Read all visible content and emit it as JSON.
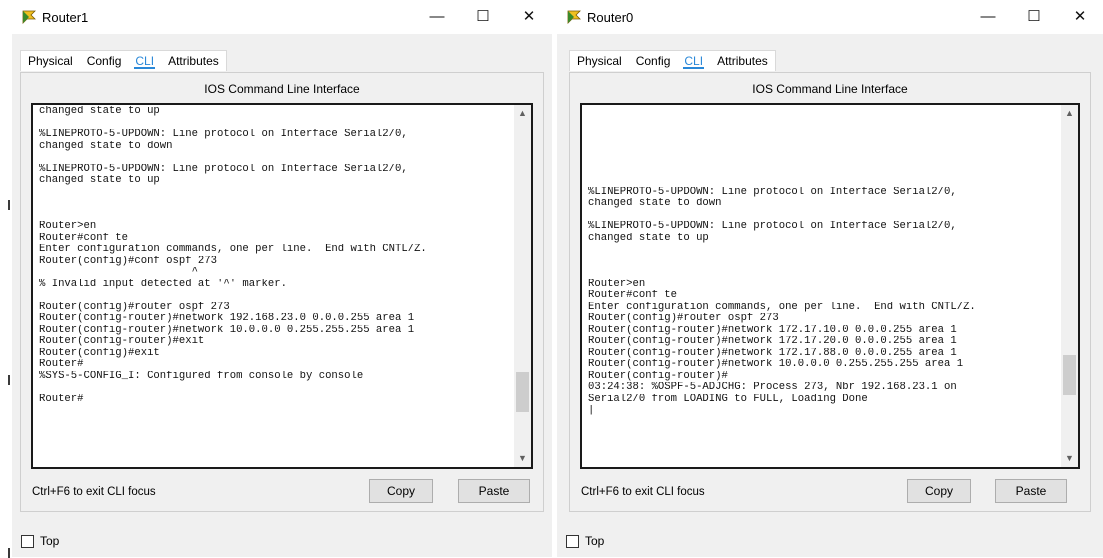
{
  "windows": [
    {
      "title": "Router1",
      "tabs": [
        "Physical",
        "Config",
        "CLI",
        "Attributes"
      ],
      "active_tab": "CLI",
      "panel_title": "IOS Command Line Interface",
      "scroll_position": 0.88,
      "lines": [
        "changed state to up",
        "",
        "%LINEPROTO-5-UPDOWN: Line protocol on Interface Serial2/0,",
        "changed state to down",
        "",
        "%LINEPROTO-5-UPDOWN: Line protocol on Interface Serial2/0,",
        "changed state to up",
        "",
        "",
        "",
        "Router>en",
        "Router#conf te",
        "Enter configuration commands, one per line.  End with CNTL/Z.",
        "Router(config)#conf ospf 273",
        "                        ^",
        "% Invalid input detected at '^' marker.",
        "",
        "Router(config)#router ospf 273",
        "Router(config-router)#network 192.168.23.0 0.0.0.255 area 1",
        "Router(config-router)#network 10.0.0.0 0.255.255.255 area 1",
        "Router(config-router)#exit",
        "Router(config)#exit",
        "Router#",
        "%SYS-5-CONFIG_I: Configured from console by console",
        "",
        "Router#"
      ],
      "hint": "Ctrl+F6 to exit CLI focus",
      "copy_label": "Copy",
      "paste_label": "Paste",
      "top_label": "Top"
    },
    {
      "title": "Router0",
      "tabs": [
        "Physical",
        "Config",
        "CLI",
        "Attributes"
      ],
      "active_tab": "CLI",
      "panel_title": "IOS Command Line Interface",
      "scroll_position": 0.82,
      "lines": [
        "",
        "",
        "",
        "",
        "",
        "",
        "",
        "%LINEPROTO-5-UPDOWN: Line protocol on Interface Serial2/0,",
        "changed state to down",
        "",
        "%LINEPROTO-5-UPDOWN: Line protocol on Interface Serial2/0,",
        "changed state to up",
        "",
        "",
        "",
        "Router>en",
        "Router#conf te",
        "Enter configuration commands, one per line.  End with CNTL/Z.",
        "Router(config)#router ospf 273",
        "Router(config-router)#network 172.17.10.0 0.0.0.255 area 1",
        "Router(config-router)#network 172.17.20.0 0.0.0.255 area 1",
        "Router(config-router)#network 172.17.88.0 0.0.0.255 area 1",
        "Router(config-router)#network 10.0.0.0 0.255.255.255 area 1",
        "Router(config-router)#",
        "03:24:38: %OSPF-5-ADJCHG: Process 273, Nbr 192.168.23.1 on",
        "Serial2/0 from LOADING to FULL, Loading Done",
        "|"
      ],
      "hint": "Ctrl+F6 to exit CLI focus",
      "copy_label": "Copy",
      "paste_label": "Paste",
      "top_label": "Top"
    }
  ],
  "icons": {
    "app": "router-icon",
    "minimize": "minimize-icon",
    "maximize": "maximize-icon",
    "close": "close-icon",
    "scroll_up": "scroll-up-arrow-icon",
    "scroll_down": "scroll-down-arrow-icon"
  },
  "colors": {
    "accent": "#2a88d8",
    "window_bg": "#f0f0f0",
    "terminal_bg": "#ffffff",
    "terminal_border": "#1a1a1a"
  }
}
